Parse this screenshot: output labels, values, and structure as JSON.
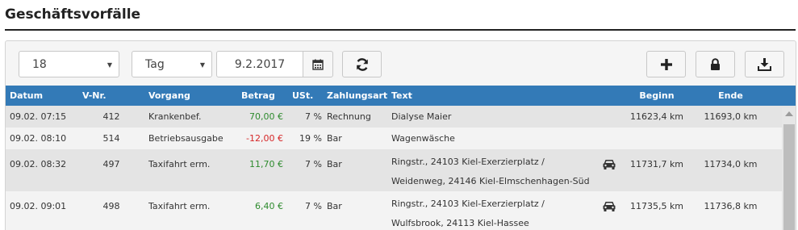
{
  "page": {
    "title": "Geschäftsvorfälle"
  },
  "toolbar": {
    "number_select": "18",
    "period_select": "Tag",
    "date_value": "9.2.2017"
  },
  "icons": {
    "calendar": "calendar-icon",
    "refresh": "refresh-icon",
    "add": "plus-icon",
    "lock": "lock-icon",
    "download": "download-icon",
    "car": "car-icon"
  },
  "colors": {
    "header_bg": "#337ab7",
    "positive": "#2e8b2e",
    "negative": "#d62728"
  },
  "table": {
    "headers": {
      "datum": "Datum",
      "vnr": "V-Nr.",
      "vorgang": "Vorgang",
      "betrag": "Betrag",
      "ust": "USt.",
      "zahlungsart": "Zahlungsart",
      "text": "Text",
      "beginn": "Beginn",
      "ende": "Ende"
    },
    "rows": [
      {
        "datum": "09.02. 07:15",
        "vnr": "412",
        "vorgang": "Krankenbef.",
        "betrag": "70,00 €",
        "ust": "7 %",
        "zahlungsart": "Rechnung",
        "text1": "Dialyse Maier",
        "text2": "",
        "beginn": "11623,4 km",
        "ende": "11693,0 km"
      },
      {
        "datum": "09.02. 08:10",
        "vnr": "514",
        "vorgang": "Betriebsausgabe",
        "betrag": "-12,00 €",
        "ust": "19 %",
        "zahlungsart": "Bar",
        "text1": "Wagenwäsche",
        "text2": "",
        "beginn": "",
        "ende": ""
      },
      {
        "datum": "09.02. 08:32",
        "vnr": "497",
        "vorgang": "Taxifahrt erm.",
        "betrag": "11,70 €",
        "ust": "7 %",
        "zahlungsart": "Bar",
        "text1": "Ringstr., 24103 Kiel-Exerzierplatz /",
        "text2": "Weidenweg, 24146 Kiel-Elmschenhagen-Süd",
        "beginn": "11731,7 km",
        "ende": "11734,0 km"
      },
      {
        "datum": "09.02. 09:01",
        "vnr": "498",
        "vorgang": "Taxifahrt erm.",
        "betrag": "6,40 €",
        "ust": "7 %",
        "zahlungsart": "Bar",
        "text1": "Ringstr., 24103 Kiel-Exerzierplatz /",
        "text2": "Wulfsbrook, 24113 Kiel-Hassee",
        "beginn": "11735,5 km",
        "ende": "11736,8 km"
      }
    ]
  }
}
